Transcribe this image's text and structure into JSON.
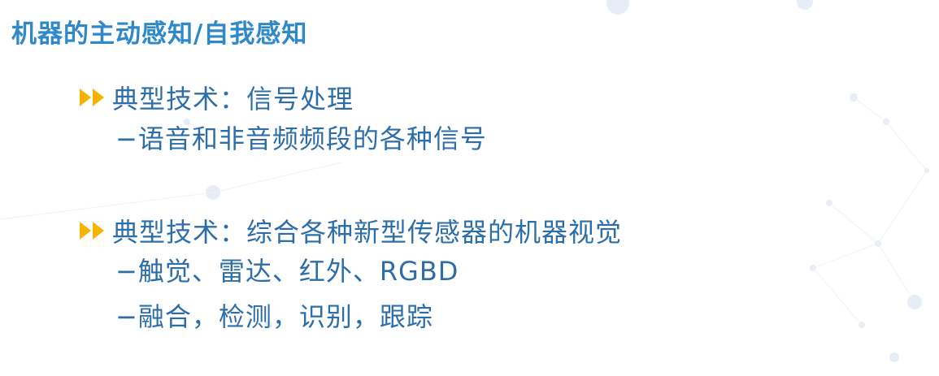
{
  "slide": {
    "title": "机器的主动感知/自我感知",
    "sections": [
      {
        "heading": "典型技术：信号处理",
        "items": [
          "−语音和非音频频段的各种信号"
        ]
      },
      {
        "heading": "典型技术：综合各种新型传感器的机器视觉",
        "items": [
          "−触觉、雷达、红外、RGBD",
          "−融合，检测，识别，跟踪"
        ]
      }
    ]
  },
  "colors": {
    "title": "#2f89c9",
    "text": "#2e6ea8",
    "bullet": "#f5b400"
  }
}
